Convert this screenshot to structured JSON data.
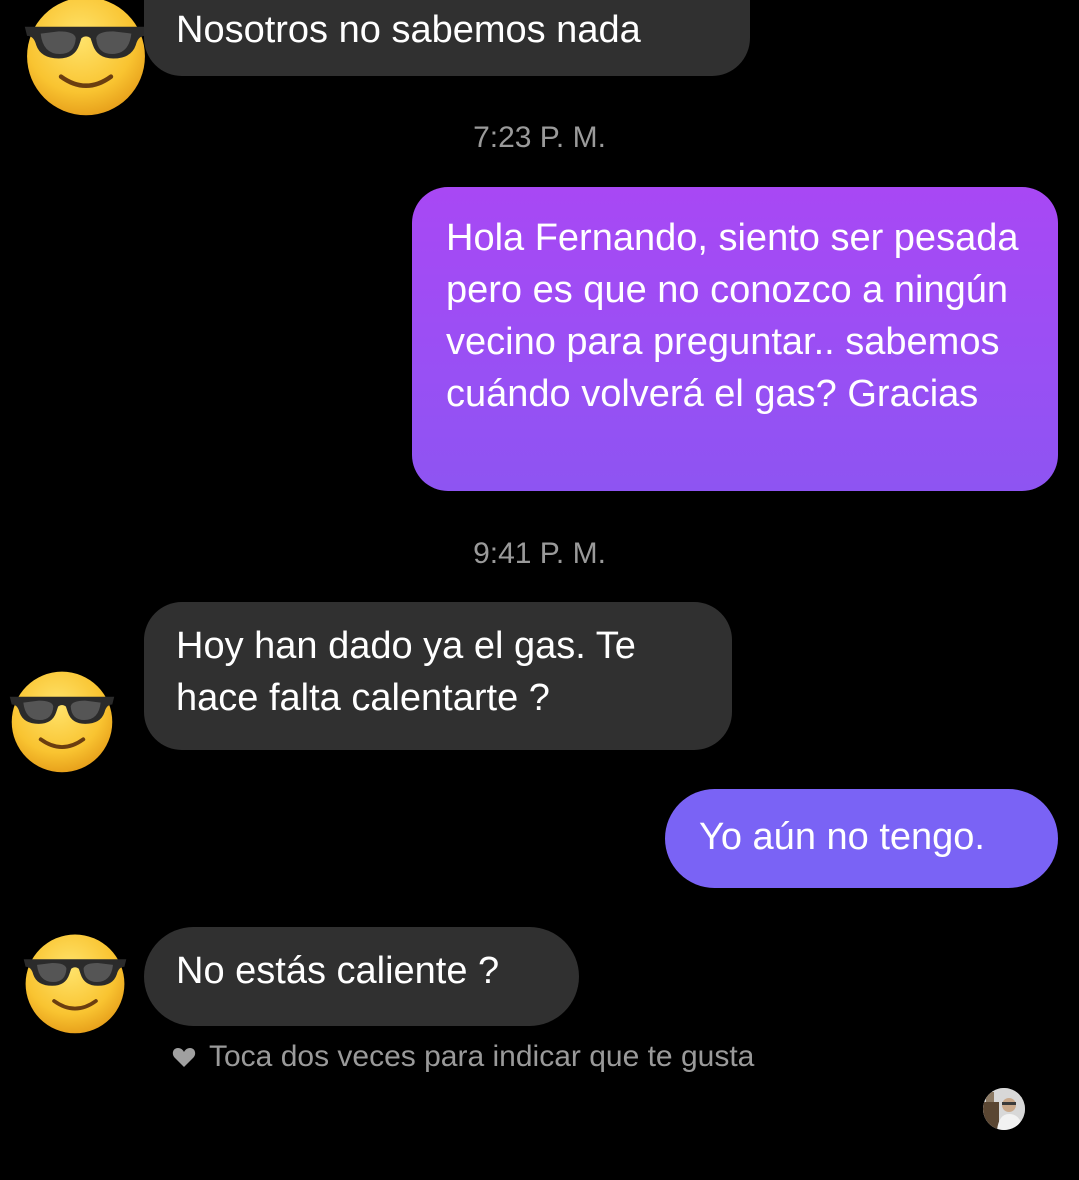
{
  "messages": [
    {
      "side": "incoming",
      "text": "Nosotros no sabemos nada"
    },
    {
      "side": "outgoing",
      "text": "Hola Fernando, siento ser pesada pero es que no conozco a ningún vecino para preguntar.. sabemos cuándo volverá el gas? Gracias"
    },
    {
      "side": "incoming",
      "text": "Hoy han dado ya el gas. Te hace falta calentarte ?"
    },
    {
      "side": "outgoing",
      "text": "Yo aún no tengo."
    },
    {
      "side": "incoming",
      "text": "No estás caliente ?"
    }
  ],
  "timestamps": [
    "7:23 P. M.",
    "9:41 P. M."
  ],
  "hint": {
    "icon": "heart-icon",
    "text": "Toca dos veces para indicar que te gusta"
  },
  "avatar_emoji": "smiling-face-with-sunglasses",
  "colors": {
    "background": "#000000",
    "incoming_bubble": "#303030",
    "outgoing_bubble_1": "#9d4ef4",
    "outgoing_bubble_2": "#7a63f5"
  }
}
